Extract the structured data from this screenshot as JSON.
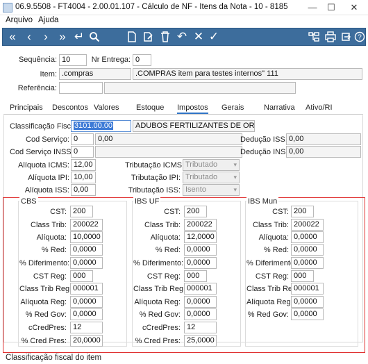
{
  "window": {
    "title": "06.9.5508 - FT4004 - 2.00.01.107 - Cálculo de NF - Itens da Nota - 10 - 8185",
    "minimize": "—",
    "maximize": "☐",
    "close": "✕"
  },
  "menu": {
    "items": [
      "Arquivo",
      "Ajuda"
    ]
  },
  "toolbar": {
    "accent": "#3d6d9c"
  },
  "header": {
    "sequencia_label": "Sequência:",
    "sequencia_value": "10",
    "nr_entrega_label": "Nr Entrega:",
    "nr_entrega_value": "0",
    "item_label": "Item:",
    "item_code": ".compras",
    "item_desc": ".COMPRAS item para testes internos\" 111",
    "referencia_label": "Referência:"
  },
  "tabs": [
    "Principais",
    "Descontos",
    "Valores",
    "Estoque",
    "Impostos",
    "Gerais",
    "Narrativa",
    "Ativo/RI"
  ],
  "impostos": {
    "class_fiscal_label": "Classificação Fiscal:",
    "class_fiscal_value": "3101.00.00",
    "class_fiscal_desc": "ADUBOS FERTILIZANTES DE ORIGEM ANIM",
    "cod_servico_label": "Cod Serviço:",
    "cod_servico_value": "0",
    "cod_servico_value2": "0,00",
    "deducao_iss_label": "Dedução ISS:",
    "deducao_iss_value": "0,00",
    "cod_servico_inss_label": "Cod Serviço INSS:",
    "cod_servico_inss_value": "0",
    "deducao_inss_label": "Dedução INSS:",
    "deducao_inss_value": "0,00",
    "aliq_icms_label": "Alíquota ICMS:",
    "aliq_icms_value": "12,00",
    "trib_icms_label": "Tributação ICMS:",
    "trib_icms_value": "Tributado",
    "aliq_ipi_label": "Alíquota IPI:",
    "aliq_ipi_value": "10,00",
    "trib_ipi_label": "Tributação IPI:",
    "trib_ipi_value": "Tributado",
    "aliq_iss_label": "Alíquota ISS:",
    "aliq_iss_value": "0,00",
    "trib_iss_label": "Tributação ISS:",
    "trib_iss_value": "Isento"
  },
  "groups": [
    {
      "title": "CBS",
      "cst": "200",
      "class_trib": "200022",
      "aliquota": "10,0000",
      "red": "0,0000",
      "diferimento": "0,0000",
      "cst_reg": "000",
      "class_trib_reg": "000001",
      "aliquota_reg": "0,0000",
      "red_gov": "0,0000",
      "ccredpres": "12",
      "cred_pres": "20,0000"
    },
    {
      "title": "IBS UF",
      "cst": "200",
      "class_trib": "200022",
      "aliquota": "12,0000",
      "red": "0,0000",
      "diferimento": "0,0000",
      "cst_reg": "000",
      "class_trib_reg": "000001",
      "aliquota_reg": "0,0000",
      "red_gov": "0,0000",
      "ccredpres": "12",
      "cred_pres": "25,0000"
    },
    {
      "title": "IBS Mun",
      "cst": "200",
      "class_trib": "200022",
      "aliquota": "0,0000",
      "red": "0,0000",
      "diferimento": "0,0000",
      "cst_reg": "000",
      "class_trib_reg": "000001",
      "aliquota_reg": "0,0000",
      "red_gov": "0,0000"
    }
  ],
  "group_labels": {
    "cst": "CST:",
    "class_trib": "Class Trib:",
    "aliquota": "Alíquota:",
    "red": "% Red:",
    "diferimento": "% Diferimento:",
    "cst_reg": "CST Reg:",
    "class_trib_reg": "Class Trib Reg:",
    "aliquota_reg": "Alíquota Reg:",
    "red_gov": "% Red Gov:",
    "ccredpres": "cCredPres:",
    "cred_pres": "% Cred Pres:"
  },
  "status": {
    "text": "Classificação fiscal do item"
  }
}
